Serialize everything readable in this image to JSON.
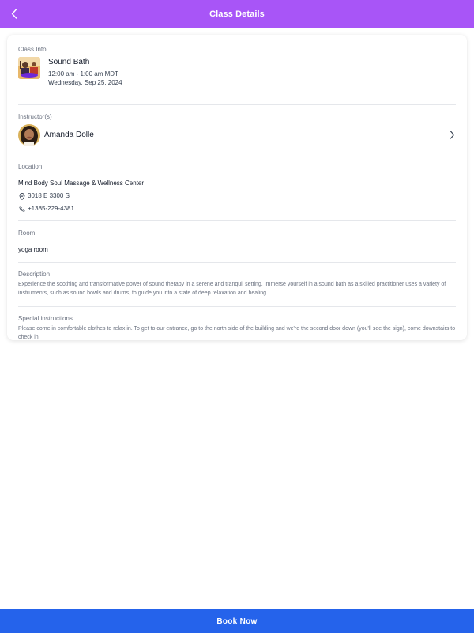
{
  "header": {
    "title": "Class Details",
    "back_icon": "chevron-left-icon",
    "background_color": "#a855f7"
  },
  "class_info": {
    "label": "Class Info",
    "name": "Sound Bath",
    "time": "12:00 am - 1:00 am MDT",
    "date": "Wednesday, Sep 25, 2024"
  },
  "instructor": {
    "label": "Instructor(s)",
    "name": "Amanda Dolle",
    "chevron_icon": "chevron-right-icon"
  },
  "location": {
    "label": "Location",
    "name": "Mind Body Soul Massage & Wellness Center",
    "address": "3018 E 3300 S",
    "phone": "+1385-229-4381",
    "address_icon": "map-pin-icon",
    "phone_icon": "phone-icon"
  },
  "room": {
    "label": "Room",
    "value": "yoga room"
  },
  "description": {
    "label": "Description",
    "text": "Experience the soothing and transformative power of sound therapy in a serene and tranquil setting. Immerse yourself in a sound bath as a skilled practitioner uses a variety of instruments, such as sound bowls and drums, to guide you into a state of deep relaxation and healing."
  },
  "special_instructions": {
    "label": "Special instructions",
    "text": "Please come in comfortable clothes to relax in. To get to our entrance, go to the north side of the building and we're the second door down (you'll see the sign), come downstairs to check in."
  },
  "footer": {
    "book_label": "Book Now",
    "background_color": "#2563eb"
  }
}
